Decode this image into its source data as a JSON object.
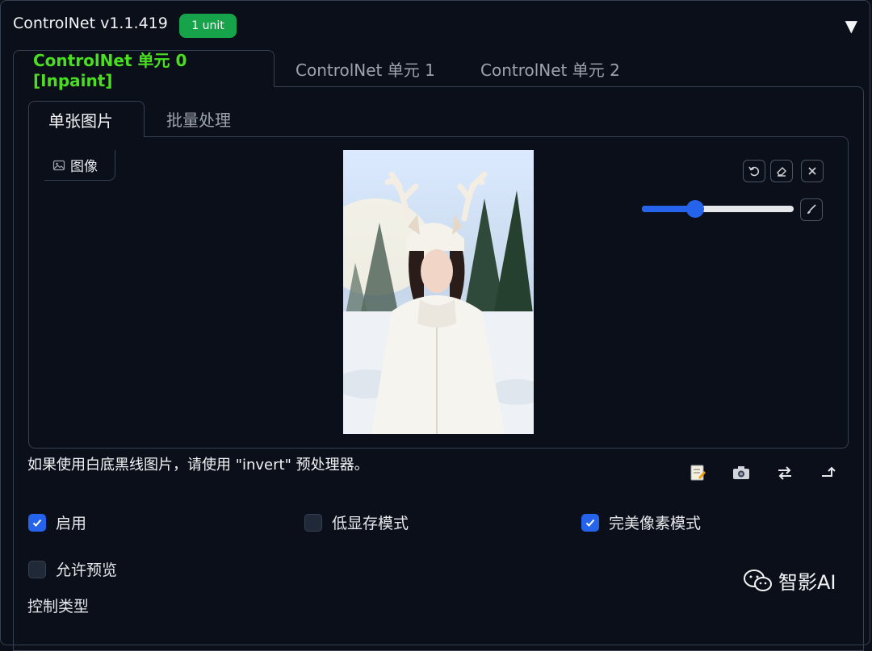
{
  "header": {
    "title": "ControlNet v1.1.419",
    "badge": "1 unit",
    "collapse_symbol": "▼"
  },
  "unit_tabs": [
    {
      "label": "ControlNet 单元 0 [Inpaint]",
      "active": true
    },
    {
      "label": "ControlNet 单元 1",
      "active": false
    },
    {
      "label": "ControlNet 单元 2",
      "active": false
    }
  ],
  "sub_tabs": [
    {
      "label": "单张图片",
      "active": true
    },
    {
      "label": "批量处理",
      "active": false
    }
  ],
  "image_panel": {
    "label": "图像",
    "brush_size_fraction": 0.35,
    "buttons": [
      "undo-icon",
      "eraser-icon",
      "close-icon",
      "brush-icon"
    ]
  },
  "hint_text": "如果使用白底黑线图片，请使用 \"invert\" 预处理器。",
  "tools": [
    "edit-icon",
    "camera-icon",
    "swap-icon",
    "send-icon"
  ],
  "checkboxes": {
    "enable": {
      "label": "启用",
      "checked": true
    },
    "low_vram": {
      "label": "低显存模式",
      "checked": false
    },
    "pixel_perfect": {
      "label": "完美像素模式",
      "checked": true
    },
    "allow_preview": {
      "label": "允许预览",
      "checked": false
    }
  },
  "control_type_label": "控制类型",
  "watermark": "智影AI",
  "colors": {
    "background": "#0b0f19",
    "accent_blue": "#2563eb",
    "active_tab_green": "#4ade20",
    "badge_green": "#16a34a"
  }
}
